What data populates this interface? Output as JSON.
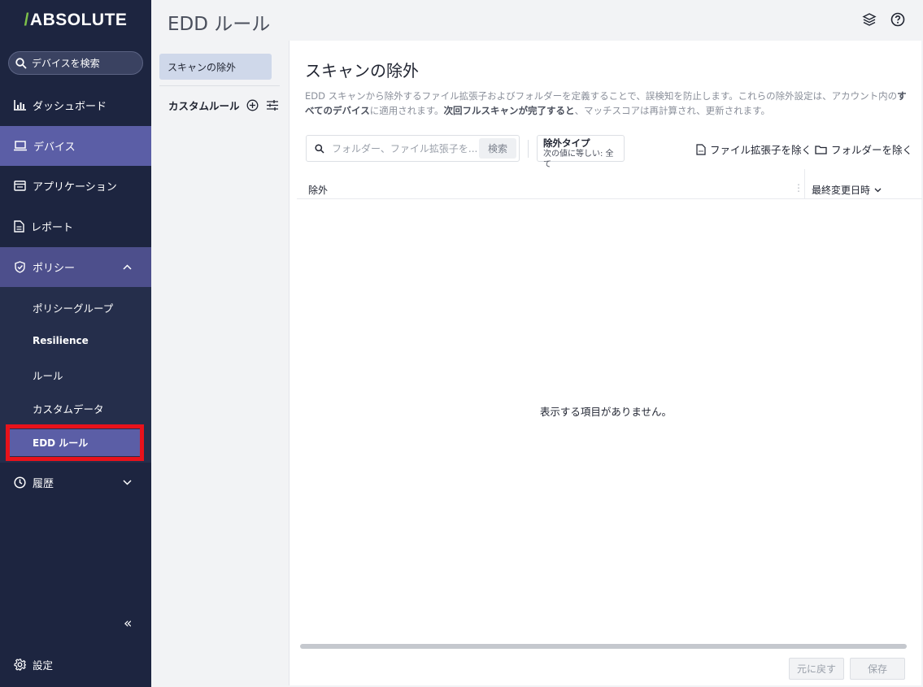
{
  "brand": {
    "slash": "/",
    "name": "ABSOLUTE"
  },
  "sidebar": {
    "search_label": "デバイスを検索",
    "items": [
      {
        "label": "ダッシュボード",
        "icon": "bar-chart-icon"
      },
      {
        "label": "デバイス",
        "icon": "laptop-icon"
      },
      {
        "label": "アプリケーション",
        "icon": "window-icon"
      },
      {
        "label": "レポート",
        "icon": "document-icon"
      },
      {
        "label": "ポリシー",
        "icon": "shield-icon"
      }
    ],
    "policy_sub": [
      "ポリシーグループ",
      "Resilience",
      "ルール",
      "カスタムデータ",
      "EDD ルール"
    ],
    "history_label": "履歴",
    "collapse_glyph": "«",
    "settings_label": "設定"
  },
  "header": {
    "title": "EDD ルール"
  },
  "col2": {
    "selected": "スキャンの除外",
    "custom_rules": "カスタムルール"
  },
  "main": {
    "title": "スキャンの除外",
    "desc_1": "EDD スキャンから除外するファイル拡張子およびフォルダーを定義することで、誤検知を防止します。これらの除外設定は、アカウント内の",
    "desc_bold_1": "すべてのデバイス",
    "desc_2": "に適用されます。",
    "desc_bold_2": "次回フルスキャンが完了すると",
    "desc_3": "、マッチスコアは再計算され、更新されます。",
    "search_placeholder": "フォルダー、ファイル拡張子を...",
    "search_button": "検索",
    "filter_title": "除外タイプ",
    "filter_value": "次の値に等しい: 全て",
    "exclude_ext": "ファイル拡張子を除く",
    "exclude_folder": "フォルダーを除く",
    "col_exclusion": "除外",
    "col_modified": "最終変更日時",
    "empty_text": "表示する項目がありません。",
    "revert_button": "元に戻す",
    "save_button": "保存"
  },
  "colors": {
    "sidebar_bg": "#1d2540",
    "active": "#5b5ea6",
    "highlight": "#e8121b",
    "brand_accent": "#7ec24a"
  }
}
